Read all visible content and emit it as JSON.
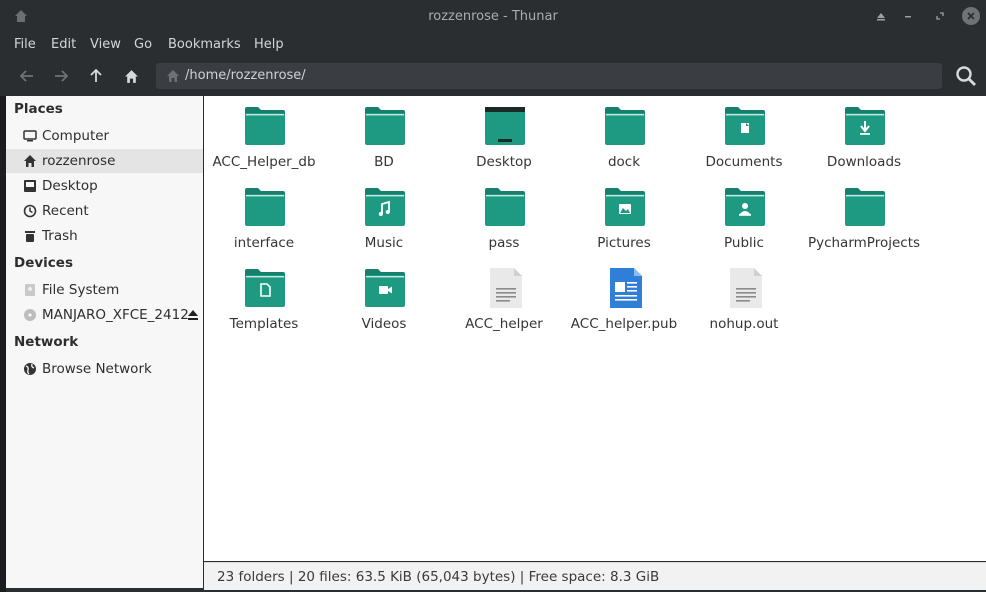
{
  "window": {
    "title": "rozzenrose - Thunar"
  },
  "menubar": {
    "items": [
      "File",
      "Edit",
      "View",
      "Go",
      "Bookmarks",
      "Help"
    ]
  },
  "toolbar": {
    "back_icon": "arrow-left-icon",
    "forward_icon": "arrow-right-icon",
    "up_icon": "arrow-up-icon",
    "home_icon": "home-icon",
    "path": "/home/rozzenrose/",
    "search_icon": "search-icon"
  },
  "sidebar": {
    "places_heading": "Places",
    "places": [
      {
        "label": "Computer",
        "icon": "computer-icon"
      },
      {
        "label": "rozzenrose",
        "icon": "home-icon",
        "selected": true
      },
      {
        "label": "Desktop",
        "icon": "desktop-icon"
      },
      {
        "label": "Recent",
        "icon": "clock-icon"
      },
      {
        "label": "Trash",
        "icon": "trash-icon"
      }
    ],
    "devices_heading": "Devices",
    "devices": [
      {
        "label": "File System",
        "icon": "drive-icon"
      },
      {
        "label": "MANJARO_XFCE_2412",
        "icon": "disc-icon",
        "eject_icon": "eject-icon"
      }
    ],
    "network_heading": "Network",
    "network": [
      {
        "label": "Browse Network",
        "icon": "globe-icon"
      }
    ]
  },
  "files": [
    {
      "name": "ACC_Helper_db",
      "type": "folder",
      "emblem": ""
    },
    {
      "name": "BD",
      "type": "folder",
      "emblem": ""
    },
    {
      "name": "Desktop",
      "type": "folder-desktop",
      "emblem": "desktop"
    },
    {
      "name": "dock",
      "type": "folder",
      "emblem": ""
    },
    {
      "name": "Documents",
      "type": "folder",
      "emblem": "document"
    },
    {
      "name": "Downloads",
      "type": "folder",
      "emblem": "download"
    },
    {
      "name": "interface",
      "type": "folder",
      "emblem": ""
    },
    {
      "name": "Music",
      "type": "folder",
      "emblem": "music"
    },
    {
      "name": "pass",
      "type": "folder",
      "emblem": ""
    },
    {
      "name": "Pictures",
      "type": "folder",
      "emblem": "picture"
    },
    {
      "name": "Public",
      "type": "folder",
      "emblem": "person"
    },
    {
      "name": "PycharmProjects",
      "type": "folder",
      "emblem": ""
    },
    {
      "name": "Templates",
      "type": "folder",
      "emblem": "template"
    },
    {
      "name": "Videos",
      "type": "folder",
      "emblem": "video"
    },
    {
      "name": "ACC_helper",
      "type": "text-file",
      "emblem": ""
    },
    {
      "name": "ACC_helper.pub",
      "type": "publisher-file",
      "emblem": ""
    },
    {
      "name": "nohup.out",
      "type": "text-file",
      "emblem": ""
    }
  ],
  "statusbar": {
    "text": "23 folders  |  20 files: 63.5 KiB (65,043 bytes)  |  Free space: 8.3 GiB"
  },
  "colors": {
    "folder": "#1e9a82",
    "folder_tab": "#17806c",
    "accent_doc": "#2f7fd8"
  }
}
